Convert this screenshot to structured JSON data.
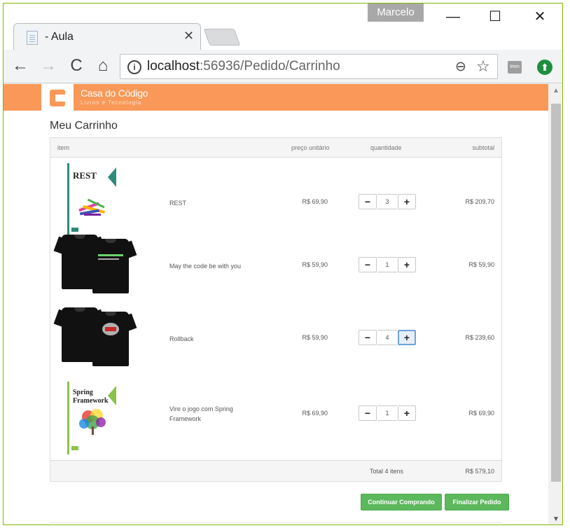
{
  "window": {
    "user": "Marcelo",
    "minimize": "—",
    "maximize": "☐",
    "close": "✕"
  },
  "tab": {
    "title": "- Aula",
    "close": "✕"
  },
  "toolbar": {
    "back": "←",
    "forward": "→",
    "reload": "C",
    "home": "⌂",
    "url_host": "localhost",
    "url_rest": ":56936/Pedido/Carrinho",
    "zoom_icon": "⊖",
    "star_icon": "☆",
    "ext_label": "Imm",
    "update_icon": "⬆"
  },
  "site": {
    "brand": "Casa do Código",
    "tagline": "Livros e Tecnologia",
    "accent": "#f99858"
  },
  "page": {
    "title": "Meu Carrinho"
  },
  "cart": {
    "headers": {
      "item": "item",
      "price": "preço unitário",
      "qty": "quantidade",
      "subtotal": "subtotal"
    },
    "rows": [
      {
        "image": "rest-book",
        "name": "REST",
        "price": "R$ 69,90",
        "qty": "3",
        "subtotal": "R$ 209,70"
      },
      {
        "image": "tshirt-code",
        "name": "May the code be with you",
        "price": "R$ 59,90",
        "qty": "1",
        "subtotal": "R$ 59,90"
      },
      {
        "image": "tshirt-rollback",
        "name": "Rollback",
        "price": "R$ 59,90",
        "qty": "4",
        "subtotal": "R$ 239,60"
      },
      {
        "image": "spring-book",
        "name": "Vire o jogo com Spring Framework",
        "price": "R$ 69,90",
        "qty": "1",
        "subtotal": "R$ 69,90"
      }
    ],
    "footer": {
      "total_label": "Total 4 itens",
      "total_value": "R$ 579,10"
    },
    "minus": "−",
    "plus": "+"
  },
  "books": {
    "rest_title": "REST",
    "spring_title": "Spring Framework"
  },
  "actions": {
    "continue": "Continuar Comprando",
    "finish": "Finalizar Pedido",
    "button_color": "#5cb85c"
  }
}
